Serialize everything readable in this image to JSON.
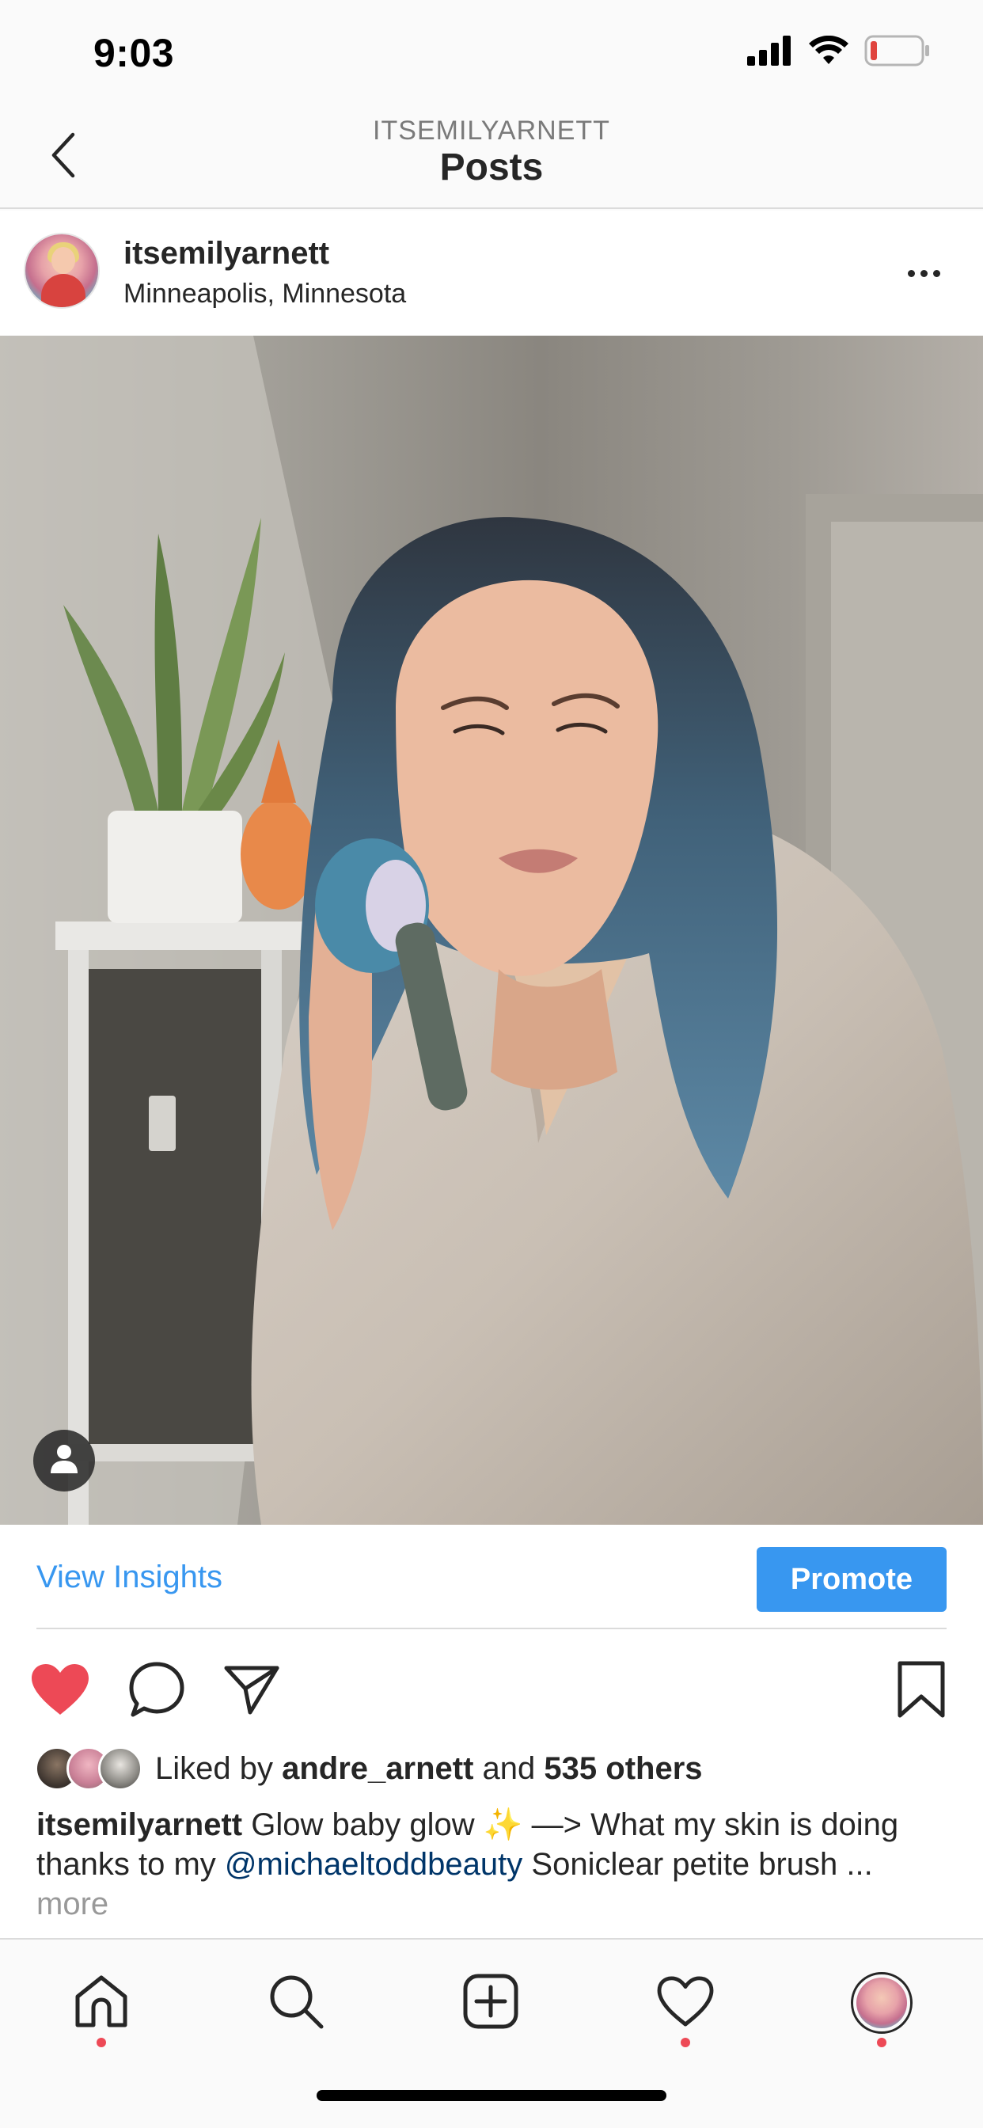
{
  "status_bar": {
    "time": "9:03",
    "icons": [
      "cellular-signal-icon",
      "wifi-icon",
      "battery-icon"
    ],
    "battery_color": "#e0443e"
  },
  "nav": {
    "subtitle": "ITSEMILYARNETT",
    "title": "Posts",
    "back_icon": "chevron-left-icon"
  },
  "post": {
    "username": "itsemilyarnett",
    "location": "Minneapolis, Minnesota",
    "more_icon": "ellipsis-icon",
    "photo_description_icon": "tagged-person-icon"
  },
  "insights": {
    "view_label": "View Insights",
    "promote_label": "Promote",
    "accent_color": "#3897f0"
  },
  "actions": {
    "like_icon": "heart-filled-icon",
    "like_color": "#ed4956",
    "comment_icon": "comment-icon",
    "share_icon": "send-icon",
    "save_icon": "bookmark-icon"
  },
  "likes": {
    "prefix": "Liked by",
    "user": "andre_arnett",
    "conjunction": "and",
    "others": "535 others"
  },
  "caption": {
    "username": "itsemilyarnett",
    "text_1": "Glow baby glow ✨ —> What my skin is doing thanks to my",
    "mention": "@michaeltoddbeauty",
    "text_2": "Soniclear petite brush ...",
    "more": "more"
  },
  "tab_bar": {
    "tabs": [
      {
        "name": "home-icon",
        "has_dot": true
      },
      {
        "name": "search-icon",
        "has_dot": false
      },
      {
        "name": "add-post-icon",
        "has_dot": false
      },
      {
        "name": "activity-heart-icon",
        "has_dot": true
      },
      {
        "name": "profile-avatar",
        "has_dot": true
      }
    ],
    "dot_color": "#ed4956"
  }
}
